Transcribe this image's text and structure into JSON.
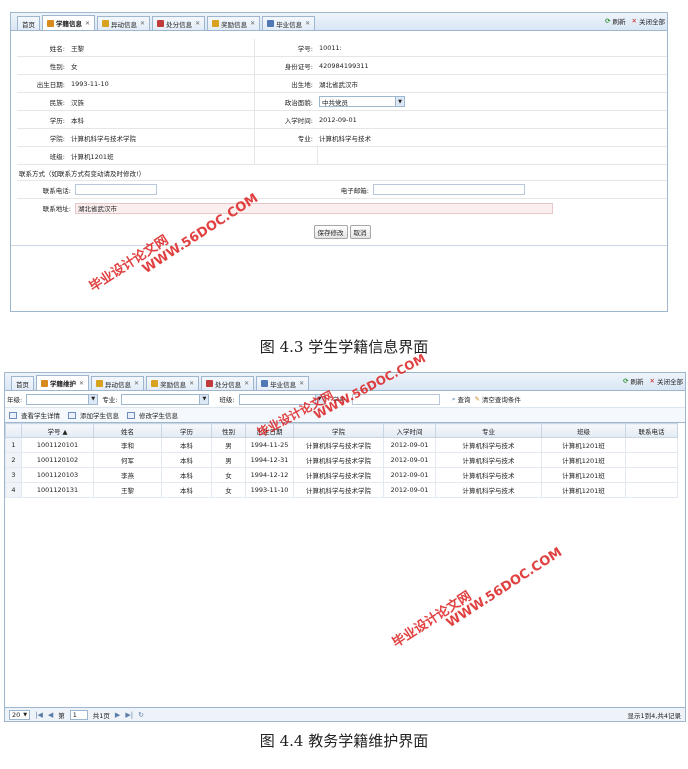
{
  "top": {
    "tabs": [
      {
        "label": "首页",
        "icon": null
      },
      {
        "label": "学籍信息",
        "icon": "#d88a1e"
      },
      {
        "label": "异动信息",
        "icon": "#d8a21e"
      },
      {
        "label": "处分信息",
        "icon": "#c23b3b"
      },
      {
        "label": "奖励信息",
        "icon": "#d8a21e"
      },
      {
        "label": "毕业信息",
        "icon": "#4f79b5"
      }
    ],
    "refresh": "刷新",
    "close_all": "关闭全部",
    "fields": {
      "name_l": "姓名:",
      "name_v": "王黎",
      "id_l": "学号:",
      "id_v": "10011:",
      "gender_l": "性别:",
      "gender_v": "女",
      "idcard_l": "身份证号:",
      "idcard_v": "420984199311",
      "birth_l": "出生日期:",
      "birth_v": "1993-11-10",
      "birthplace_l": "出生地:",
      "birthplace_v": "湖北省武汉市",
      "nation_l": "民族:",
      "nation_v": "汉族",
      "politics_l": "政治面貌:",
      "politics_v": "中共党员",
      "edu_l": "学历:",
      "edu_v": "本科",
      "enroll_l": "入学时间:",
      "enroll_v": "2012-09-01",
      "college_l": "学院:",
      "college_v": "计算机科学与技术学院",
      "major_l": "专业:",
      "major_v": "计算机科学与技术",
      "class_l": "班级:",
      "class_v": "计算机1201班"
    },
    "contact_section": "联系方式（如联系方式有变动请及时修改!）",
    "phone_l": "联系电话:",
    "email_l": "电子邮箱:",
    "address_l": "联系地址:",
    "address_v": "湖北省武汉市",
    "save": "保存修改",
    "cancel": "取消",
    "caption": "图 4.3  学生学籍信息界面"
  },
  "bottom": {
    "tabs": [
      {
        "label": "首页",
        "icon": null
      },
      {
        "label": "学籍维护",
        "icon": "#d88a1e"
      },
      {
        "label": "异动信息",
        "icon": "#d8a21e"
      },
      {
        "label": "奖励信息",
        "icon": "#d8a21e"
      },
      {
        "label": "处分信息",
        "icon": "#c23b3b"
      },
      {
        "label": "毕业信息",
        "icon": "#4f79b5"
      }
    ],
    "refresh": "刷新",
    "close_all": "关闭全部",
    "filters": {
      "grade": "年级:",
      "major": "专业:",
      "class": "班级:",
      "id": "学号:",
      "search": "查询",
      "clear": "清空查询条件"
    },
    "toolbar": {
      "view": "查看学生详情",
      "add": "添加学生信息",
      "edit": "修改学生信息"
    },
    "columns": [
      "学号 ▲",
      "姓名",
      "学历",
      "性别",
      "出生日期",
      "学院",
      "入学时间",
      "专业",
      "班级",
      "联系电话"
    ],
    "rows": [
      [
        "1",
        "1001120101",
        "李和",
        "本科",
        "男",
        "1994-11-25",
        "计算机科学与技术学院",
        "2012-09-01",
        "计算机科学与技术",
        "计算机1201班",
        ""
      ],
      [
        "2",
        "1001120102",
        "何军",
        "本科",
        "男",
        "1994-12-31",
        "计算机科学与技术学院",
        "2012-09-01",
        "计算机科学与技术",
        "计算机1201班",
        ""
      ],
      [
        "3",
        "1001120103",
        "李燕",
        "本科",
        "女",
        "1994-12-12",
        "计算机科学与技术学院",
        "2012-09-01",
        "计算机科学与技术",
        "计算机1201班",
        ""
      ],
      [
        "4",
        "1001120131",
        "王黎",
        "本科",
        "女",
        "1993-11-10",
        "计算机科学与技术学院",
        "2012-09-01",
        "计算机科学与技术",
        "计算机1201班",
        ""
      ]
    ],
    "pager": {
      "size": "20",
      "page_label": "第",
      "page": "1",
      "total": "共1页",
      "info": "显示1到4,共4记录"
    },
    "caption": "图 4.4  教务学籍维护界面"
  },
  "watermark": {
    "site": "WWW.56DOC.COM",
    "brand": "毕业设计论文网"
  }
}
